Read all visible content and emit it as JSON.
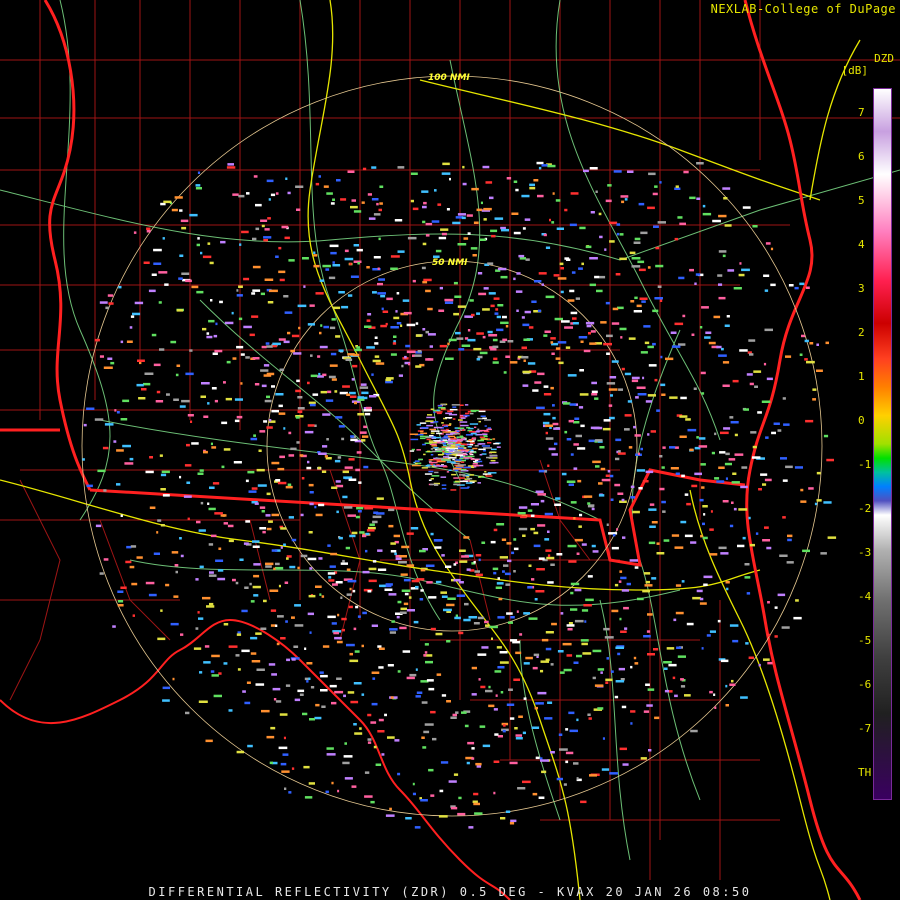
{
  "header": {
    "credit": "NEXLAB-College of DuPage"
  },
  "footer": {
    "caption": "DIFFERENTIAL REFLECTIVITY (ZDR) 0.5 DEG - KVAX 20 JAN 26 08:50"
  },
  "range_rings": [
    {
      "label": "100 NMI"
    },
    {
      "label": "50 NMI"
    }
  ],
  "scale": {
    "title": "DZD",
    "units": "[dB]",
    "ticks": [
      "7",
      "6",
      "5",
      "4",
      "3",
      "2",
      "1",
      "0",
      "-1",
      "-2",
      "-3",
      "-4",
      "-5",
      "-6",
      "-7",
      "TH"
    ],
    "colors": {
      "border": "#ff2020",
      "county": "#c02020",
      "highway": "#e6e600",
      "road": "#7fe08a",
      "ring": "#e6c890",
      "text": "#e6e600"
    }
  }
}
